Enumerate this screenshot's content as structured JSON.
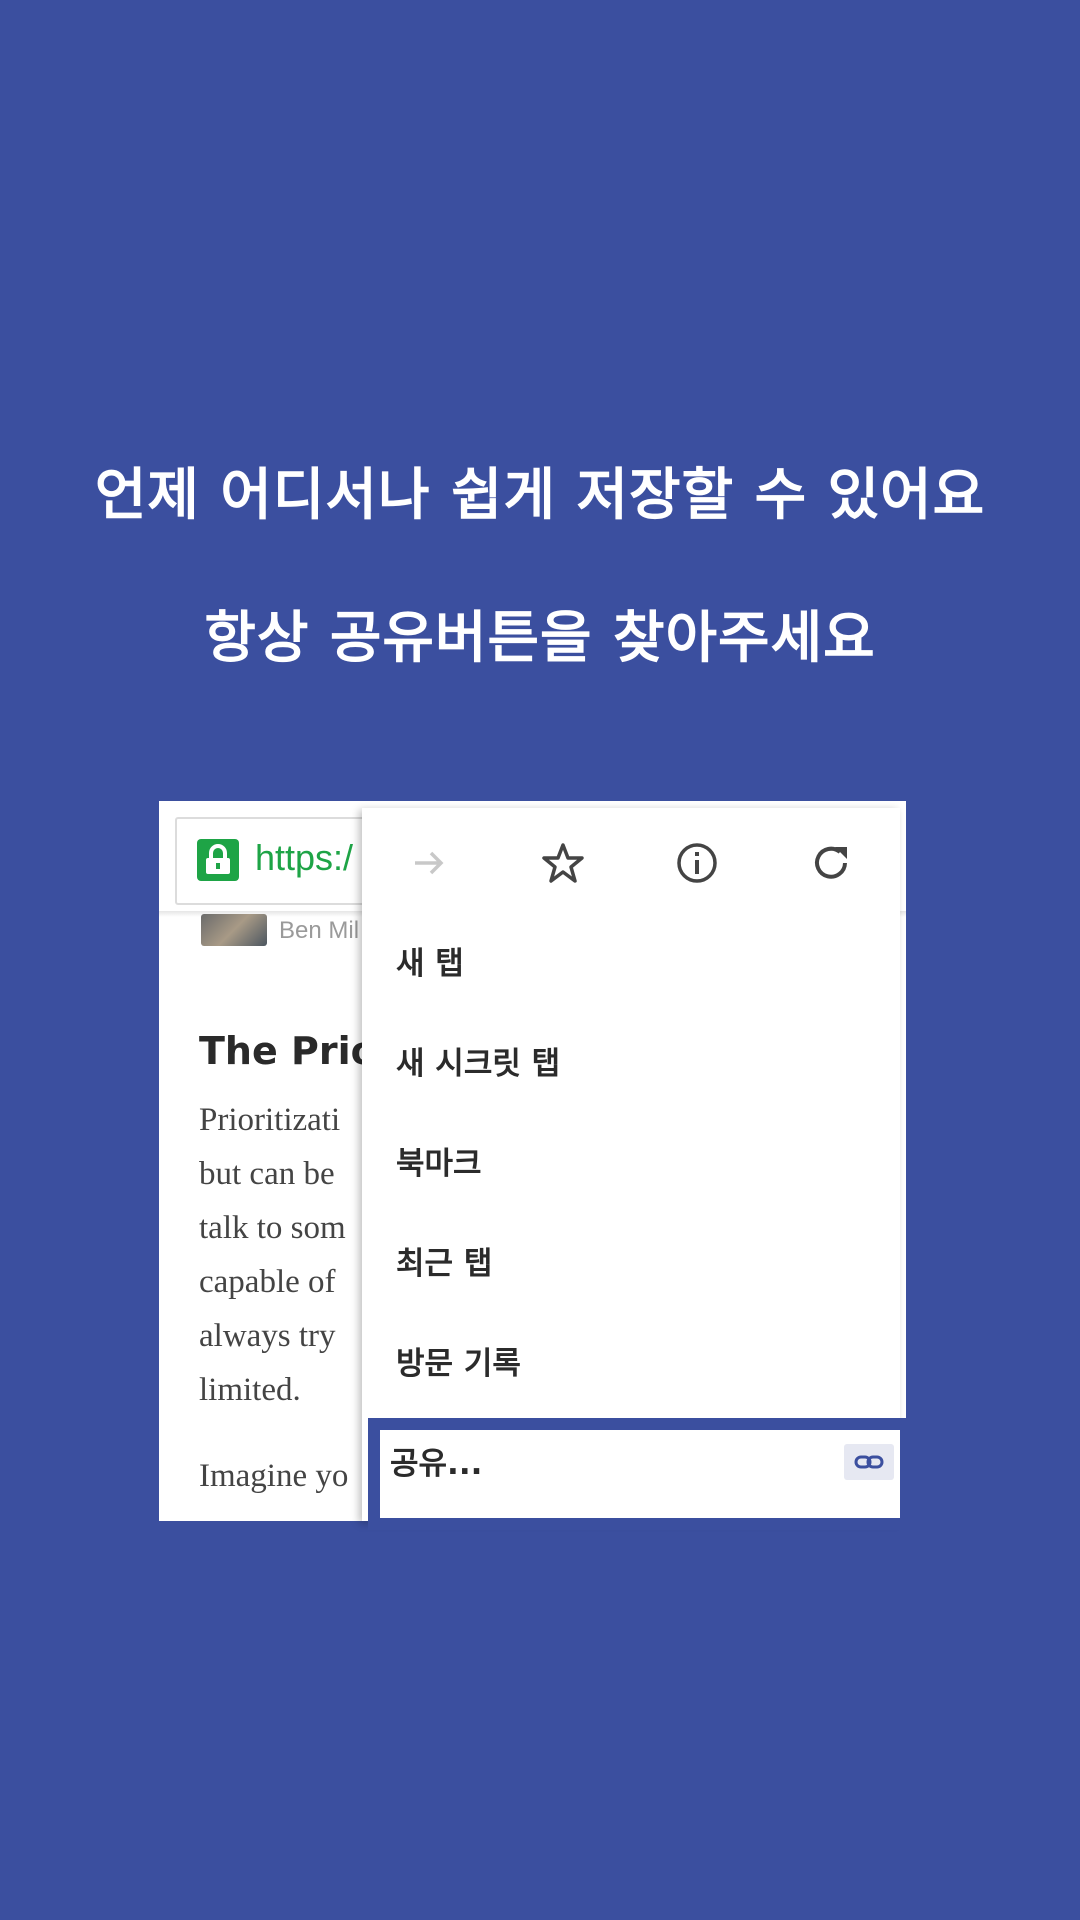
{
  "headline": {
    "line1": "언제 어디서나 쉽게 저장할 수 있어요",
    "line2": "항상 공유버튼을 찾아주세요"
  },
  "browser": {
    "url": "https:/",
    "article": {
      "author": "Ben Mil",
      "title": "The Prior",
      "lines": [
        "Prioritizati",
        "but can be",
        "talk to som",
        "capable of",
        "always try",
        "limited."
      ],
      "para2": "Imagine yo"
    }
  },
  "menu": {
    "icons": [
      "forward-icon",
      "star-icon",
      "info-icon",
      "reload-icon"
    ],
    "items": [
      "새 탭",
      "새 시크릿 탭",
      "북마크",
      "최근 탭",
      "방문 기록"
    ],
    "share": "공유...",
    "highlight_color": "#3b4f9f"
  },
  "colors": {
    "background": "#3b4f9f",
    "secure_green": "#1ea446"
  }
}
